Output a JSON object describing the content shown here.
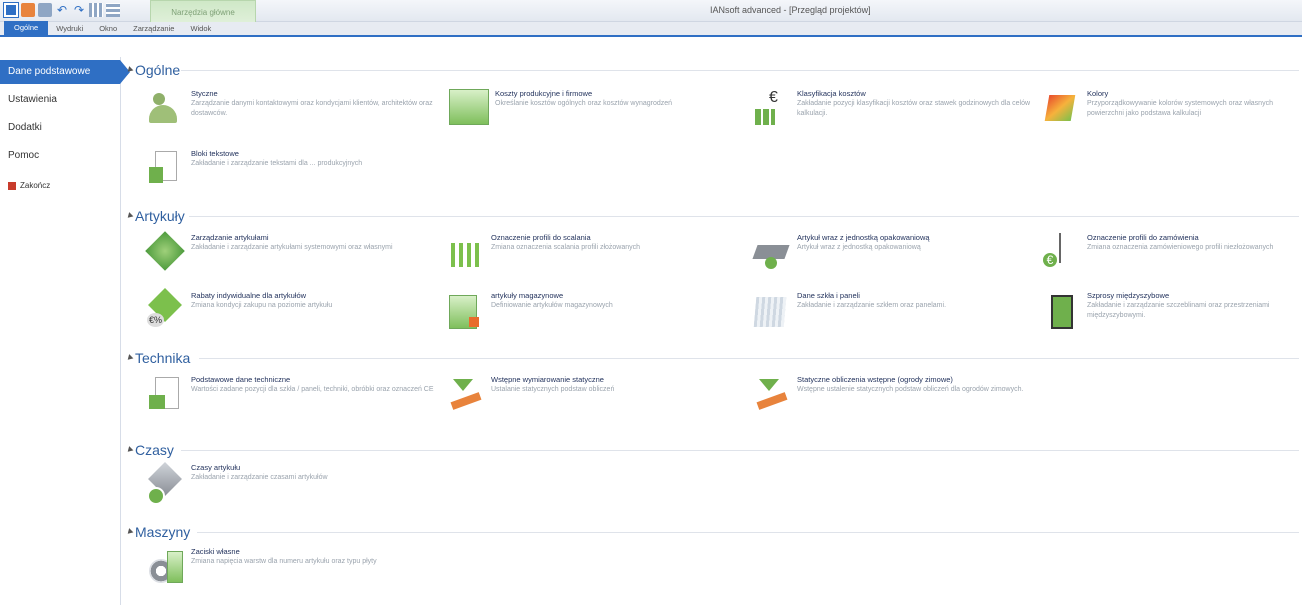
{
  "window": {
    "title": "IANsoft advanced - [Przegląd projektów]",
    "context_tab": "Narzędzia główne"
  },
  "ribbon": {
    "tabs": [
      "Ogólne",
      "Wydruki",
      "Okno",
      "Zarządzanie",
      "Widok"
    ]
  },
  "sidebar": {
    "items": [
      "Dane podstawowe",
      "Ustawienia",
      "Dodatki",
      "Pomoc"
    ],
    "exit_label": "Zakończ"
  },
  "sections": [
    {
      "title": "Ogólne",
      "items": [
        {
          "icon": "users-icon",
          "title": "Styczne",
          "desc": "Zarządzanie danymi kontaktowymi oraz kondycjami klientów, architektów oraz dostawców."
        },
        {
          "icon": "building-euro-icon",
          "title": "Koszty produkcyjne i firmowe",
          "desc": "Określanie kosztów ogólnych oraz kosztów wynagrodzeń"
        },
        {
          "icon": "cost-chart-icon",
          "title": "Klasyfikacja kosztów",
          "desc": "Zakładanie pozycji klasyfikacji kosztów oraz stawek godzinowych dla celów kalkulacji."
        },
        {
          "icon": "colors-icon",
          "title": "Kolory",
          "desc": "Przyporządkowywanie kolorów systemowych oraz własnych powierzchni jako podstawa kalkulacji"
        },
        {
          "icon": "text-blocks-icon",
          "title": "Bloki tekstowe",
          "desc": "Zakładanie i zarządzanie tekstami dla ... produkcyjnych"
        }
      ]
    },
    {
      "title": "Artykuły",
      "items": [
        {
          "icon": "cubes-icon",
          "title": "Zarządzanie artykułami",
          "desc": "Zakładanie i zarządzanie artykułami systemowymi oraz własnymi"
        },
        {
          "icon": "profiles-icon",
          "title": "Oznaczenie profili do scalania",
          "desc": "Zmiana oznaczenia scalania profili złożowanych"
        },
        {
          "icon": "pallet-icon",
          "title": "Artykuł wraz z jednostką opakowaniową",
          "desc": "Artykuł wraz z jednostką opakowaniową"
        },
        {
          "icon": "order-profile-icon",
          "title": "Oznaczenie profili do zamówienia",
          "desc": "Zmiana oznaczenia zamówieniowego profili niezłożowanych"
        },
        {
          "icon": "discount-icon",
          "title": "Rabaty indywidualne dla artykułów",
          "desc": "Zmiana kondycji zakupu na poziomie artykułu"
        },
        {
          "icon": "stock-icon",
          "title": "artykuły magazynowe",
          "desc": "Definiowanie artykułów magazynowych"
        },
        {
          "icon": "glass-panels-icon",
          "title": "Dane szkła i paneli",
          "desc": "Zakładanie i zarządzanie szkłem oraz panelami."
        },
        {
          "icon": "spacers-icon",
          "title": "Szprosy międzyszybowe",
          "desc": "Zakładanie i zarządzanie szczeblinami oraz przestrzeniami międzyszybowymi."
        }
      ]
    },
    {
      "title": "Technika",
      "items": [
        {
          "icon": "tech-data-icon",
          "title": "Podstawowe dane techniczne",
          "desc": "Wartości zadane pozycji dla szkła / paneli, techniki, obróbki oraz oznaczeń CE"
        },
        {
          "icon": "static-icon",
          "title": "Wstępne wymiarowanie statyczne",
          "desc": "Ustalanie statycznych podstaw obliczeń"
        },
        {
          "icon": "winter-garden-icon",
          "title": "Statyczne obliczenia wstępne (ogrody zimowe)",
          "desc": "Wstępne ustalenie statycznych podstaw obliczeń dla ogrodów zimowych."
        }
      ]
    },
    {
      "title": "Czasy",
      "items": [
        {
          "icon": "time-icon",
          "title": "Czasy artykułu",
          "desc": "Zakładanie i zarządzanie czasami artykułów"
        }
      ]
    },
    {
      "title": "Maszyny",
      "items": [
        {
          "icon": "clamp-icon",
          "title": "Zaciski własne",
          "desc": "Zmiana napięcia warstw dla numeru artykułu oraz typu płyty"
        }
      ]
    }
  ]
}
